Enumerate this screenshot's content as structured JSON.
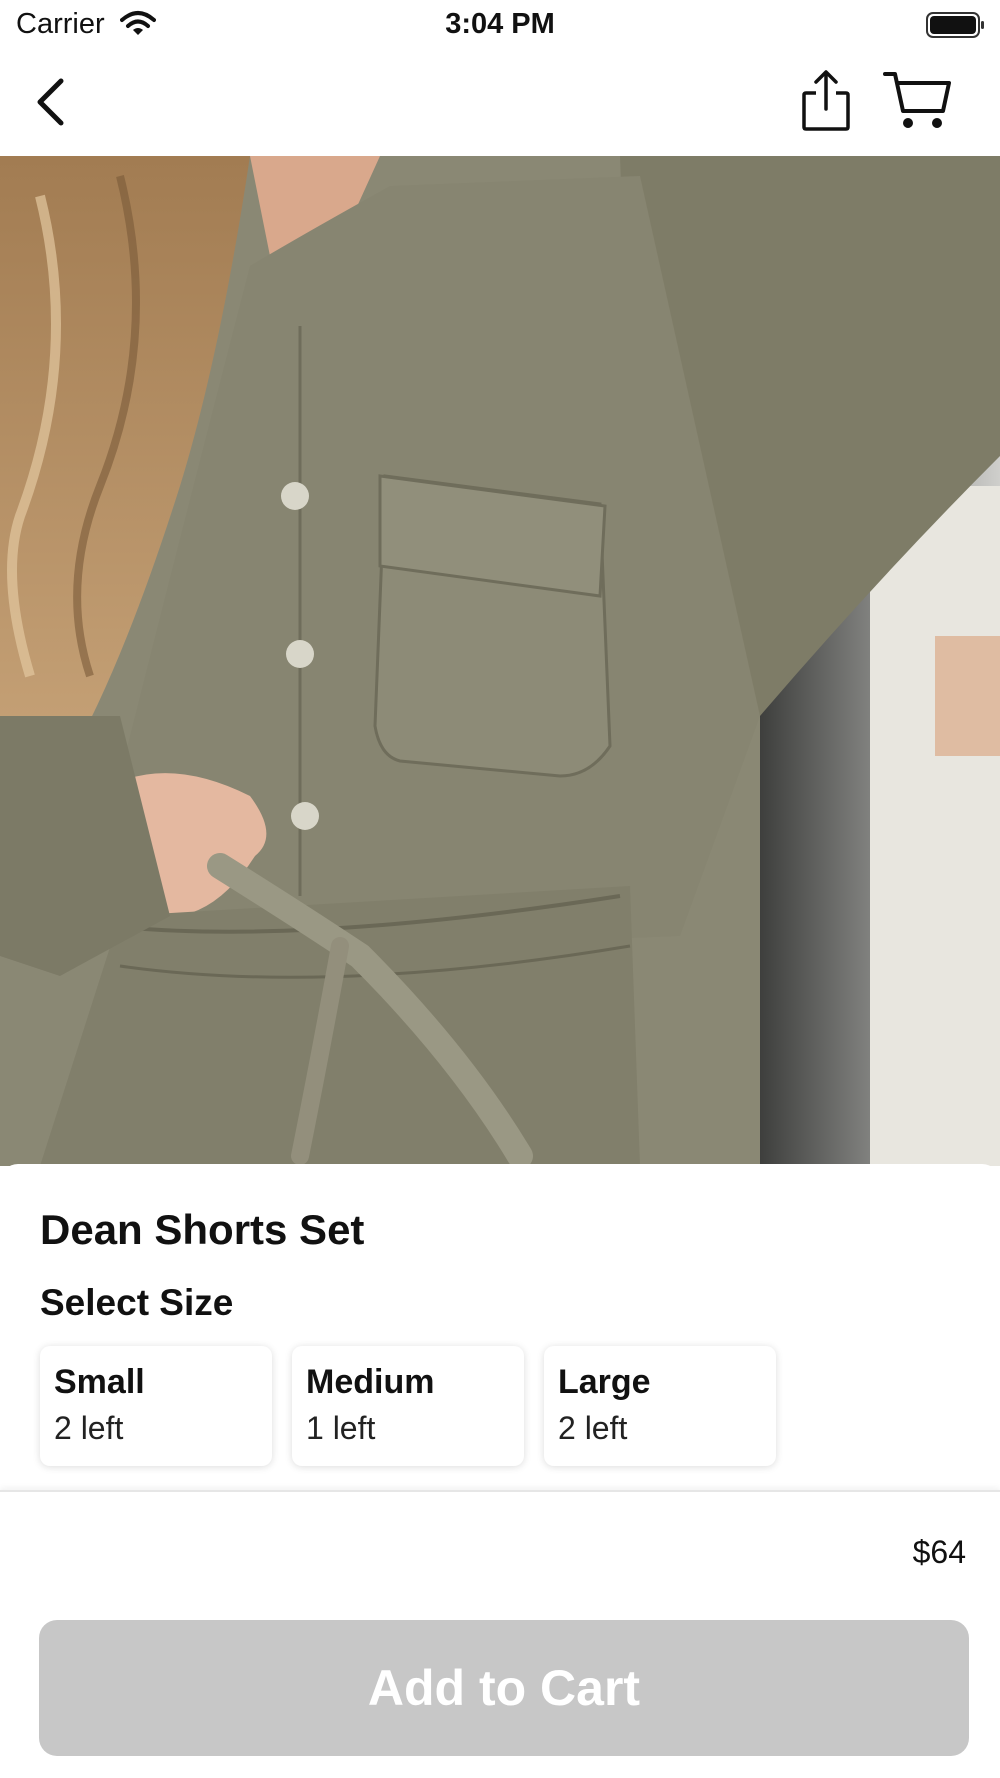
{
  "status_bar": {
    "carrier": "Carrier",
    "time": "3:04 PM",
    "icons": [
      "wifi-icon",
      "battery-icon"
    ]
  },
  "nav": {
    "icons": [
      "chevron-left-icon",
      "share-icon",
      "shopping-cart-icon"
    ]
  },
  "product": {
    "image_subject": "olive green button-up shirt and paper-bag tie-waist shorts",
    "title": "Dean Shorts Set",
    "select_size_label": "Select Size",
    "sizes": [
      {
        "name": "Small",
        "stock": "2 left"
      },
      {
        "name": "Medium",
        "stock": "1 left"
      },
      {
        "name": "Large",
        "stock": "2 left"
      }
    ],
    "price": "$64"
  },
  "actions": {
    "add_to_cart_label": "Add to Cart"
  },
  "colors": {
    "add_to_cart_disabled_bg": "#c7c7c7",
    "add_to_cart_text": "#ffffff",
    "fabric_olive": "#8a8874"
  }
}
